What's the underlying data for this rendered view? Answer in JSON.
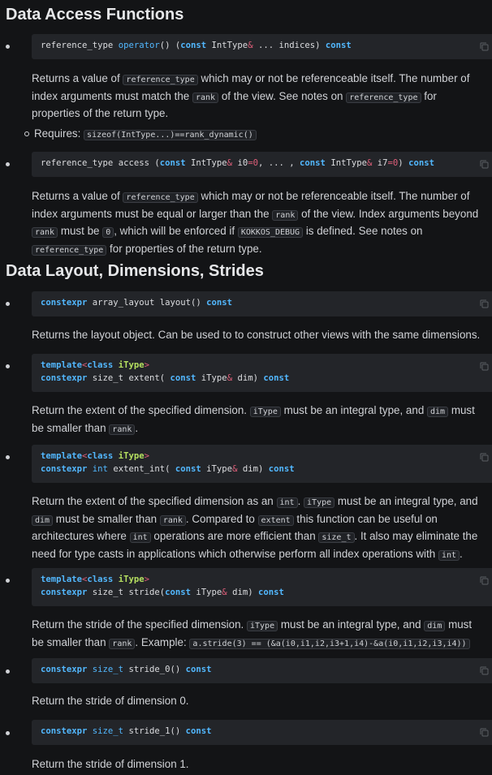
{
  "sections": [
    {
      "title": "Data Access Functions"
    },
    {
      "title": "Data Layout, Dimensions, Strides"
    }
  ],
  "text": {
    "returns_a_value_of": "Returns a value of",
    "reference_type": "reference_type",
    "rank": "rank",
    "p1_a": "which may or not be referenceable itself. The number of index arguments must match the",
    "p1_b": "of the view. See notes on",
    "p1_c": "for properties of the return type.",
    "requires_label": "Requires:",
    "requires_code": "sizeof(IntType...)==rank_dynamic()",
    "p2_a": "which may or not be referenceable itself. The number of index arguments must be equal or larger than the",
    "p2_b": "of the view. Index arguments beyond",
    "p2_c": "must be",
    "zero": "0",
    "p2_d": ", which will be enforced if",
    "kokkos_debug": "KOKKOS_DEBUG",
    "p2_e": "is defined. See notes on",
    "p2_f": "for properties of the return type.",
    "layout_desc": "Returns the layout object. Can be used to to construct other views with the same dimensions.",
    "extent_a": "Return the extent of the specified dimension.",
    "iType": "iType",
    "dim": "dim",
    "int": "int",
    "extent": "extent",
    "size_t": "size_t",
    "must_be_integral": "must be an integral type, and",
    "must_be_smaller": "must be smaller than",
    "period": ".",
    "extent_int_a": "Return the extent of the specified dimension as an",
    "extent_int_b": "Compared to",
    "extent_int_c": "this function can be useful on architectures where",
    "extent_int_d": "operations are more efficient than",
    "extent_int_e": ". It also may eliminate the need for type casts in applications which otherwise perform all index operations with",
    "stride_a": "Return the stride of the specified dimension.",
    "stride_example_label": "Example:",
    "stride_example": "a.stride(3) == (&a(i0,i1,i2,i3+1,i4)-&a(i0,i1,i2,i3,i4))",
    "stride0_desc": "Return the stride of dimension 0.",
    "stride1_desc": "Return the stride of dimension 1."
  },
  "code": {
    "reference_type": "reference_type",
    "operator": "operator",
    "parens": "()",
    "const": "const",
    "IntType": "IntType",
    "amp": "&",
    "indices": "... indices)",
    "open_paren": " (",
    "access": "access",
    "i0": "i0",
    "i7": "i7",
    "eq": "=",
    "zero": "0",
    "ellipsis": ", ... , ",
    "close_paren": ")",
    "constexpr": "constexpr",
    "array_layout": "array_layout",
    "layout_fn": "layout()",
    "template": "template",
    "lt": "<",
    "gt": ">",
    "class": "class",
    "iType": "iType",
    "size_t": "size_t",
    "int": "int",
    "extent_open": "extent(",
    "extent_int_open": "extent_int(",
    "stride_open": "stride(",
    "dim_close": "dim)",
    "stride_0": "stride_0()",
    "stride_1": "stride_1()"
  },
  "icons": {
    "copy": "copy-icon"
  }
}
